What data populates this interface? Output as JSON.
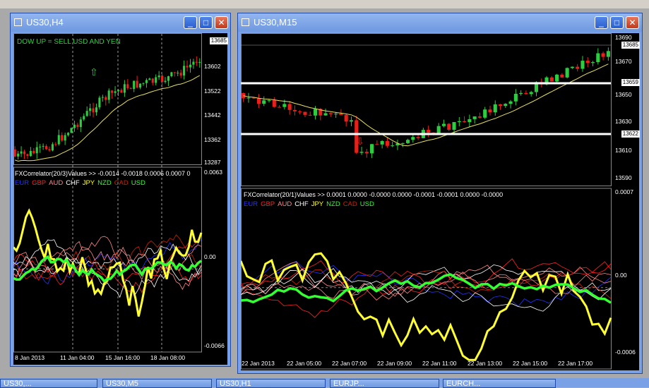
{
  "colors": {
    "up": "#2ecc40",
    "down": "#e8201a",
    "eur": "#2233ff",
    "gbp": "#ff2222",
    "aud": "#ff8888",
    "chf": "#ffffff",
    "jpy": "#ffff33",
    "nzd": "#33ff33",
    "cad": "#cc2200",
    "usd": "#33ff33"
  },
  "window1": {
    "title": "US30,H4",
    "annotation": "DOW UP = SELL USD AND YEN",
    "price_box": "13685",
    "price_axis": [
      "13602",
      "13522",
      "13442",
      "13362",
      "13287"
    ],
    "indicator_label": "FXCorrelator(20/3)Values >> -0.0014 -0.0018 0.0006 0.0007 0",
    "ind_axis": [
      "0.0063",
      "0.00",
      "-0.0066"
    ],
    "dates": [
      "8 Jan 2013",
      "11 Jan 04:00",
      "15 Jan 16:00",
      "18 Jan 08:00"
    ]
  },
  "window2": {
    "title": "US30,M15",
    "price_box_top": "13685",
    "price_box_mid": "13659",
    "price_box_low": "13622",
    "price_axis": [
      "13690",
      "13670",
      "13650",
      "13630",
      "13610",
      "13590"
    ],
    "indicator_label": "FXCorrelator(20/1)Values >> 0.0001 0.0000 -0.0000 0.0000 -0.0001 -0.0001 0.0000 -0.0000",
    "ind_axis": [
      "0.0007",
      "0.00",
      "-0.0006"
    ],
    "dates": [
      "22 Jan 2013",
      "22 Jan 05:00",
      "22 Jan 07:00",
      "22 Jan 09:00",
      "22 Jan 11:00",
      "22 Jan 13:00",
      "22 Jan 15:00",
      "22 Jan 17:00"
    ]
  },
  "currencies": [
    "EUR",
    "GBP",
    "AUD",
    "CHF",
    "JPY",
    "NZD",
    "CAD",
    "USD"
  ],
  "taskbar": [
    "US30,...",
    "US30,M5",
    "US30,H1",
    "EURJP...",
    "EURCH..."
  ],
  "buttons": {
    "minimize": "_",
    "maximize": "□",
    "close": "✕"
  }
}
